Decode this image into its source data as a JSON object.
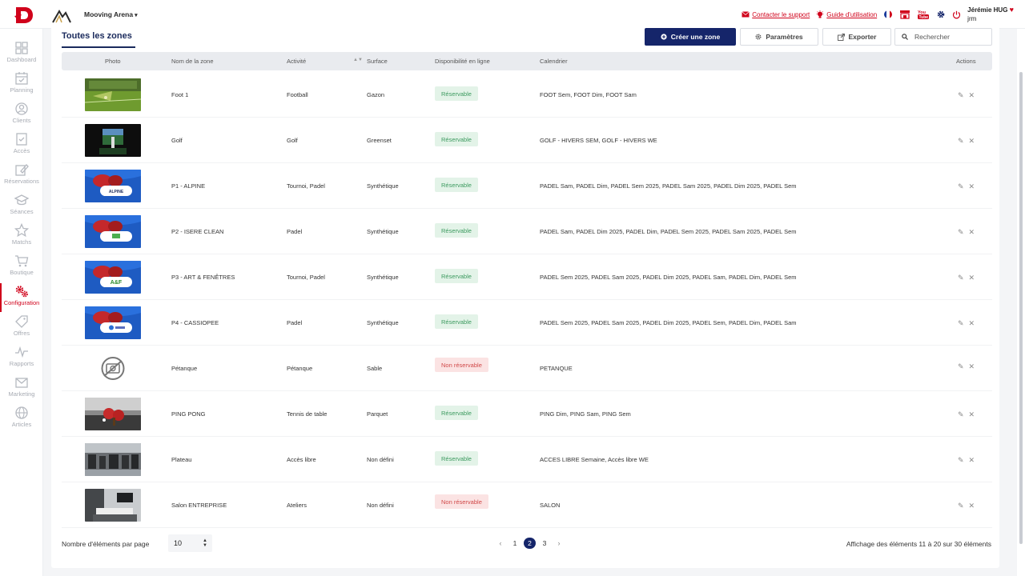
{
  "header": {
    "venue": "Mooving Arena",
    "support_link": "Contacter le support",
    "guide_link": "Guide d'utilisation",
    "user_name": "Jérémie HUG",
    "user_login": "jrm"
  },
  "sidebar": {
    "items": [
      {
        "label": "Dashboard",
        "icon": "dashboard-icon"
      },
      {
        "label": "Planning",
        "icon": "calendar-icon"
      },
      {
        "label": "Clients",
        "icon": "user-icon"
      },
      {
        "label": "Accès",
        "icon": "access-icon"
      },
      {
        "label": "Réservations",
        "icon": "reservation-icon"
      },
      {
        "label": "Séances",
        "icon": "graduation-icon"
      },
      {
        "label": "Matchs",
        "icon": "star-icon"
      },
      {
        "label": "Boutique",
        "icon": "cart-icon"
      },
      {
        "label": "Configuration",
        "icon": "gears-icon",
        "active": true
      },
      {
        "label": "Offres",
        "icon": "tag-icon"
      },
      {
        "label": "Rapports",
        "icon": "pulse-icon"
      },
      {
        "label": "Marketing",
        "icon": "mail-icon"
      },
      {
        "label": "Articles",
        "icon": "globe-icon"
      }
    ]
  },
  "main": {
    "title": "Toutes les zones",
    "create_label": "Créer une zone",
    "params_label": "Paramètres",
    "export_label": "Exporter",
    "search_placeholder": "Rechercher",
    "columns": [
      "Photo",
      "Nom de la zone",
      "Activité",
      "Surface",
      "Disponibilité en ligne",
      "Calendrier",
      "Actions"
    ],
    "rows": [
      {
        "name": "Foot 1",
        "activity": "Football",
        "surface": "Gazon",
        "status": "Réservable",
        "bookable": true,
        "calendar": "FOOT Sem, FOOT Dim, FOOT Sam",
        "photo": "football-turf"
      },
      {
        "name": "Golf",
        "activity": "Golf",
        "surface": "Greenset",
        "status": "Réservable",
        "bookable": true,
        "calendar": "GOLF - HIVERS SEM, GOLF - HIVERS WE",
        "photo": "golf-simulator"
      },
      {
        "name": "P1 - ALPINE",
        "activity": "Tournoi, Padel",
        "surface": "Synthétique",
        "status": "Réservable",
        "bookable": true,
        "calendar": "PADEL Sam, PADEL Dim, PADEL Sem 2025, PADEL Sam 2025, PADEL Dim 2025, PADEL Sem",
        "photo": "padel-alpine",
        "sponsor": "ALPINE"
      },
      {
        "name": "P2 - ISERE CLEAN",
        "activity": "Padel",
        "surface": "Synthétique",
        "status": "Réservable",
        "bookable": true,
        "calendar": "PADEL Sam, PADEL Dim 2025, PADEL Dim, PADEL Sem 2025, PADEL Sam 2025, PADEL Sem",
        "photo": "padel-isere"
      },
      {
        "name": "P3 - ART & FENÊTRES",
        "activity": "Tournoi, Padel",
        "surface": "Synthétique",
        "status": "Réservable",
        "bookable": true,
        "calendar": "PADEL Sem 2025, PADEL Sam 2025, PADEL Dim 2025, PADEL Sam, PADEL Dim, PADEL Sem",
        "photo": "padel-af",
        "sponsor": "A&F"
      },
      {
        "name": "P4 - CASSIOPEE",
        "activity": "Padel",
        "surface": "Synthétique",
        "status": "Réservable",
        "bookable": true,
        "calendar": "PADEL Sem 2025, PADEL Sam 2025, PADEL Dim 2025, PADEL Sem, PADEL Dim, PADEL Sam",
        "photo": "padel-cassiopee"
      },
      {
        "name": "Pétanque",
        "activity": "Pétanque",
        "surface": "Sable",
        "status": "Non réservable",
        "bookable": false,
        "calendar": "PETANQUE",
        "photo": "no-photo"
      },
      {
        "name": "PING PONG",
        "activity": "Tennis de table",
        "surface": "Parquet",
        "status": "Réservable",
        "bookable": true,
        "calendar": "PING Dim, PING Sam, PING Sem",
        "photo": "ping-pong"
      },
      {
        "name": "Plateau",
        "activity": "Accès libre",
        "surface": "Non défini",
        "status": "Réservable",
        "bookable": true,
        "calendar": "ACCES LIBRE Semaine, Accès libre WE",
        "photo": "gym"
      },
      {
        "name": "Salon ENTREPRISE",
        "activity": "Ateliers",
        "surface": "Non défini",
        "status": "Non réservable",
        "bookable": false,
        "calendar": "SALON",
        "photo": "meeting-room"
      }
    ]
  },
  "footer": {
    "per_page_label": "Nombre d'éléments par page",
    "per_page_value": "10",
    "pages": [
      "1",
      "2",
      "3"
    ],
    "current_page": "2",
    "prev": "‹",
    "next": "›",
    "summary": "Affichage des éléments 11 à 20 sur 30 éléments"
  },
  "colors": {
    "brand_red": "#d0021b",
    "navy": "#15256a",
    "ok_bg": "#e3f3e8",
    "ok_fg": "#3c9a5f",
    "no_bg": "#fbe3e3",
    "no_fg": "#d04848"
  }
}
